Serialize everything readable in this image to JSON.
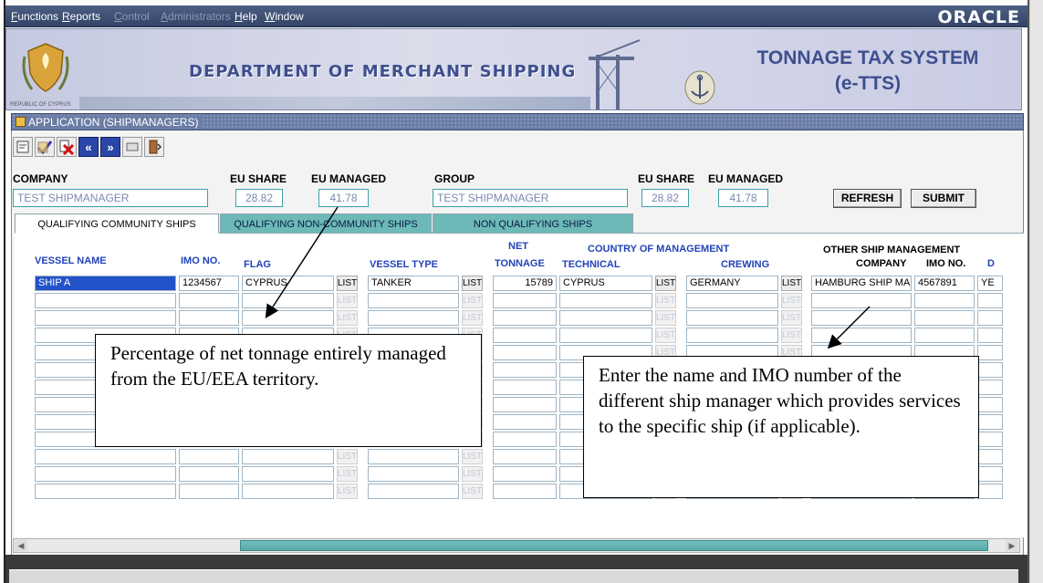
{
  "menubar": {
    "items": [
      "Functions",
      "Reports",
      "Control",
      "Administrators",
      "Help",
      "Window"
    ],
    "brand": "ORACLE"
  },
  "banner": {
    "crest_caption": "REPUBLIC OF CYPRUS",
    "department": "DEPARTMENT OF MERCHANT SHIPPING",
    "system_line1": "TONNAGE TAX SYSTEM",
    "system_line2": "(e-TTS)"
  },
  "window": {
    "title": "APPLICATION (SHIPMANAGERS)"
  },
  "toolbar": {
    "icons": [
      "query-icon",
      "save-icon",
      "delete-icon",
      "previous-icon",
      "next-icon",
      "print-icon",
      "exit-icon"
    ],
    "prev_glyph": "«",
    "next_glyph": "»"
  },
  "header": {
    "company_label": "COMPANY",
    "company_value": "TEST SHIPMANAGER",
    "eu_share_label": "EU SHARE",
    "eu_share_value": "28.82",
    "eu_managed_label": "EU MANAGED",
    "eu_managed_value": "41.78",
    "group_label": "GROUP",
    "group_value": "TEST SHIPMANAGER",
    "group_eu_share_label": "EU SHARE",
    "group_eu_share_value": "28.82",
    "group_eu_managed_label": "EU MANAGED",
    "group_eu_managed_value": "41.78",
    "refresh_label": "REFRESH",
    "submit_label": "SUBMIT"
  },
  "tabs": [
    {
      "label": "QUALIFYING COMMUNITY SHIPS",
      "active": true
    },
    {
      "label": "QUALIFYING NON-COMMUNITY SHIPS",
      "active": false
    },
    {
      "label": "NON QUALIFYING SHIPS",
      "active": false
    }
  ],
  "grid": {
    "headers": {
      "vessel_name": "VESSEL NAME",
      "imo_no": "IMO NO.",
      "flag": "FLAG",
      "vessel_type": "VESSEL TYPE",
      "net_top": "NET",
      "net_bottom": "TONNAGE",
      "com_top": "COUNTRY OF MANAGEMENT",
      "technical": "TECHNICAL",
      "crewing": "CREWING",
      "osm_top": "OTHER SHIP MANAGEMENT",
      "osm_company": "COMPANY",
      "osm_imo": "IMO NO.",
      "trailing": "D"
    },
    "list_label": "LIST",
    "row1": {
      "vessel_name": "SHIP A",
      "imo_no": "1234567",
      "flag": "CYPRUS",
      "vessel_type": "TANKER",
      "net_tonnage": "15789",
      "technical": "CYPRUS",
      "crewing": "GERMANY",
      "osm_company": "HAMBURG SHIP MA",
      "osm_imo": "4567891",
      "trailing": "YE"
    }
  },
  "callouts": {
    "left": "Percentage of net tonnage entirely managed from the EU/EEA territory.",
    "right": "Enter the name and IMO number of the different ship manager which provides services to the specific ship (if applicable)."
  },
  "statusbar": {
    "text": ""
  },
  "colors": {
    "accent_blue": "#2243b8",
    "tab_teal": "#6cb9b8",
    "banner_title": "#3e4f8e",
    "menubar": "#3d4e73"
  }
}
